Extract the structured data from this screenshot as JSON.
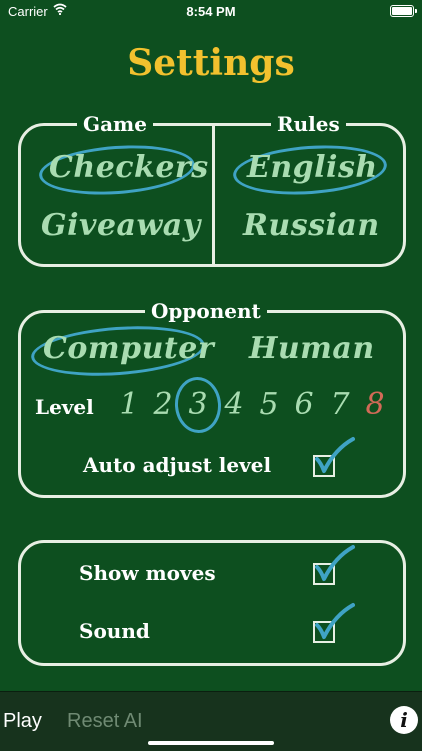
{
  "status_bar": {
    "carrier": "Carrier",
    "time": "8:54 PM"
  },
  "title": "Settings",
  "game_panel": {
    "label": "Game",
    "options": [
      "Checkers",
      "Giveaway"
    ],
    "selected": "Checkers"
  },
  "rules_panel": {
    "label": "Rules",
    "options": [
      "English",
      "Russian"
    ],
    "selected": "English"
  },
  "opponent_panel": {
    "label": "Opponent",
    "options": [
      "Computer",
      "Human"
    ],
    "selected": "Computer",
    "level_label": "Level",
    "levels": [
      "1",
      "2",
      "3",
      "4",
      "5",
      "6",
      "7",
      "8"
    ],
    "selected_level": "3",
    "auto_adjust_label": "Auto adjust level",
    "auto_adjust_checked": true
  },
  "options_panel": {
    "show_moves_label": "Show moves",
    "show_moves_checked": true,
    "sound_label": "Sound",
    "sound_checked": true
  },
  "toolbar": {
    "play_label": "Play",
    "reset_label": "Reset AI",
    "info_label": "i"
  },
  "colors": {
    "background": "#0d4f1f",
    "title": "#f2c12e",
    "option_text": "#a9dcb1",
    "selection_circle": "#3fa3c4",
    "max_level": "#d26a57"
  }
}
